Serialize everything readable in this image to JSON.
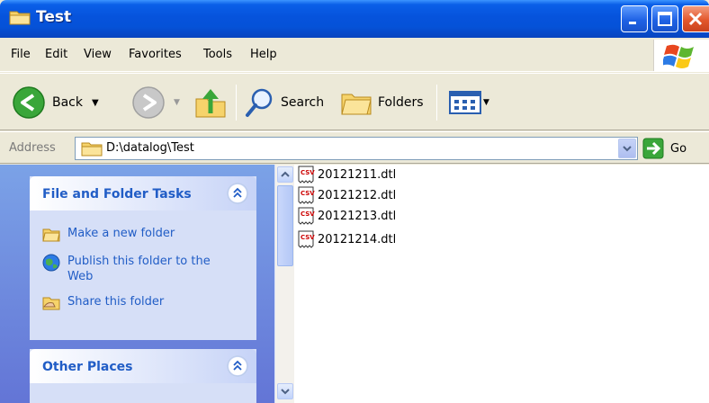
{
  "window": {
    "title": "Test"
  },
  "menu": {
    "items": [
      "File",
      "Edit",
      "View",
      "Favorites",
      "Tools",
      "Help"
    ]
  },
  "toolbar": {
    "back": "Back",
    "search": "Search",
    "folders": "Folders"
  },
  "address": {
    "label": "Address",
    "path": "D:\\datalog\\Test",
    "go": "Go"
  },
  "tasks_panel": {
    "title": "File and Folder Tasks",
    "items": [
      {
        "label": "Make a new folder"
      },
      {
        "label": "Publish this folder to the Web"
      },
      {
        "label": "Share this folder"
      }
    ]
  },
  "places_panel": {
    "title": "Other Places"
  },
  "files": [
    {
      "name": "20121211.dtl"
    },
    {
      "name": "20121212.dtl"
    },
    {
      "name": "20121213.dtl"
    },
    {
      "name": "20121214.dtl"
    }
  ]
}
